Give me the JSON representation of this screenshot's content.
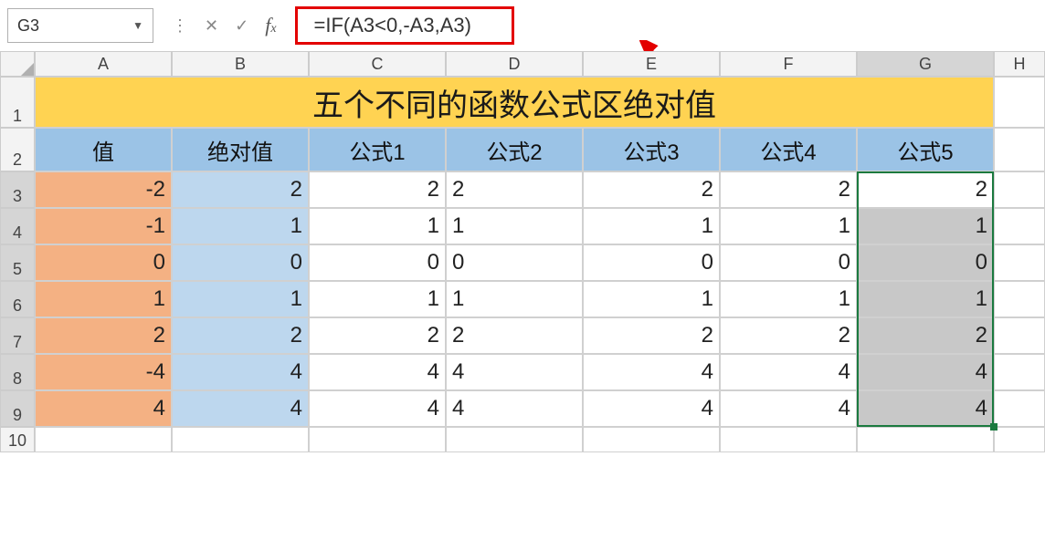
{
  "name_box": "G3",
  "formula": "=IF(A3<0,-A3,A3)",
  "col_labels": [
    "A",
    "B",
    "C",
    "D",
    "E",
    "F",
    "G",
    "H"
  ],
  "row_labels": [
    "1",
    "2",
    "3",
    "4",
    "5",
    "6",
    "7",
    "8",
    "9",
    "10"
  ],
  "title": "五个不同的函数公式区绝对值",
  "headers": [
    "值",
    "绝对值",
    "公式1",
    "公式2",
    "公式3",
    "公式4",
    "公式5"
  ],
  "rows": [
    {
      "A": "-2",
      "B": "2",
      "C": "2",
      "D": "2",
      "E": "2",
      "F": "2",
      "G": "2"
    },
    {
      "A": "-1",
      "B": "1",
      "C": "1",
      "D": "1",
      "E": "1",
      "F": "1",
      "G": "1"
    },
    {
      "A": "0",
      "B": "0",
      "C": "0",
      "D": "0",
      "E": "0",
      "F": "0",
      "G": "0"
    },
    {
      "A": "1",
      "B": "1",
      "C": "1",
      "D": "1",
      "E": "1",
      "F": "1",
      "G": "1"
    },
    {
      "A": "2",
      "B": "2",
      "C": "2",
      "D": "2",
      "E": "2",
      "F": "2",
      "G": "2"
    },
    {
      "A": "-4",
      "B": "4",
      "C": "4",
      "D": "4",
      "E": "4",
      "F": "4",
      "G": "4"
    },
    {
      "A": "4",
      "B": "4",
      "C": "4",
      "D": "4",
      "E": "4",
      "F": "4",
      "G": "4"
    }
  ],
  "chart_data": {
    "type": "table",
    "title": "五个不同的函数公式区绝对值",
    "columns": [
      "值",
      "绝对值",
      "公式1",
      "公式2",
      "公式3",
      "公式4",
      "公式5"
    ],
    "data": [
      [
        -2,
        2,
        2,
        2,
        2,
        2,
        2
      ],
      [
        -1,
        1,
        1,
        1,
        1,
        1,
        1
      ],
      [
        0,
        0,
        0,
        0,
        0,
        0,
        0
      ],
      [
        1,
        1,
        1,
        1,
        1,
        1,
        1
      ],
      [
        2,
        2,
        2,
        2,
        2,
        2,
        2
      ],
      [
        -4,
        4,
        4,
        4,
        4,
        4,
        4
      ],
      [
        4,
        4,
        4,
        4,
        4,
        4,
        4
      ]
    ]
  }
}
